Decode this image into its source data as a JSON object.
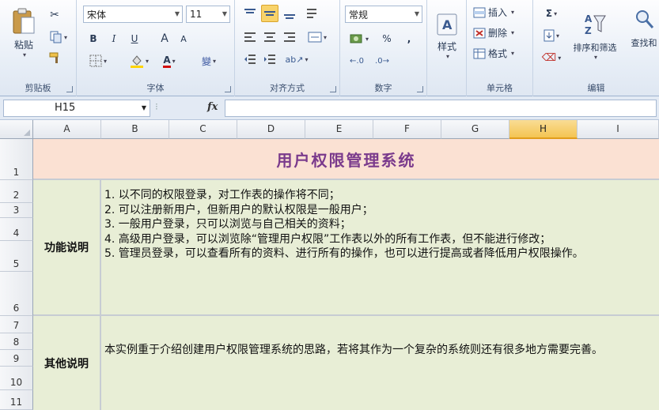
{
  "ribbon": {
    "clipboard": {
      "paste_label": "粘贴",
      "group_label": "剪贴板"
    },
    "font": {
      "font_name": "宋体",
      "font_size": "11",
      "group_label": "字体",
      "bold": "B",
      "italic": "I",
      "underline": "U",
      "grow": "A",
      "shrink": "A",
      "phonetic": "變"
    },
    "alignment": {
      "group_label": "对齐方式"
    },
    "number": {
      "format": "常规",
      "percent": "%",
      "comma": ",",
      "group_label": "数字"
    },
    "styles": {
      "label": "样式"
    },
    "cells": {
      "insert": "插入",
      "delete": "删除",
      "format": "格式",
      "group_label": "单元格"
    },
    "editing": {
      "sum": "Σ",
      "sort_filter": "排序和筛选",
      "find_select": "查找和",
      "group_label": "编辑"
    }
  },
  "formula_bar": {
    "name_box": "H15",
    "fx": "fx",
    "value": ""
  },
  "sheet": {
    "columns": [
      "A",
      "B",
      "C",
      "D",
      "E",
      "F",
      "G",
      "H",
      "I"
    ],
    "selected_column": "H",
    "rows": [
      "1",
      "2",
      "3",
      "4",
      "5",
      "6",
      "7",
      "8",
      "9",
      "10",
      "11"
    ],
    "title": "用户权限管理系统",
    "section1": {
      "label": "功能说明",
      "lines": [
        "1. 以不同的权限登录，对工作表的操作将不同；",
        "2. 可以注册新用户，但新用户的默认权限是一般用户；",
        "3. 一般用户登录，只可以浏览与自己相关的资料；",
        "4. 高级用户登录，可以浏览除“管理用户权限”工作表以外的所有工作表，但不能进行修改；",
        "5. 管理员登录，可以查看所有的资料、进行所有的操作，也可以进行提高或者降低用户权限操作。"
      ]
    },
    "section2": {
      "label": "其他说明",
      "text": "本实例重于介绍创建用户权限管理系统的思路，若将其作为一个复杂的系统则还有很多地方需要完善。"
    }
  },
  "colors": {
    "title_bg": "#fbe1d3",
    "title_text": "#7a3a8c",
    "content_bg": "#e8eed6",
    "selected_header": "#f4c452"
  }
}
